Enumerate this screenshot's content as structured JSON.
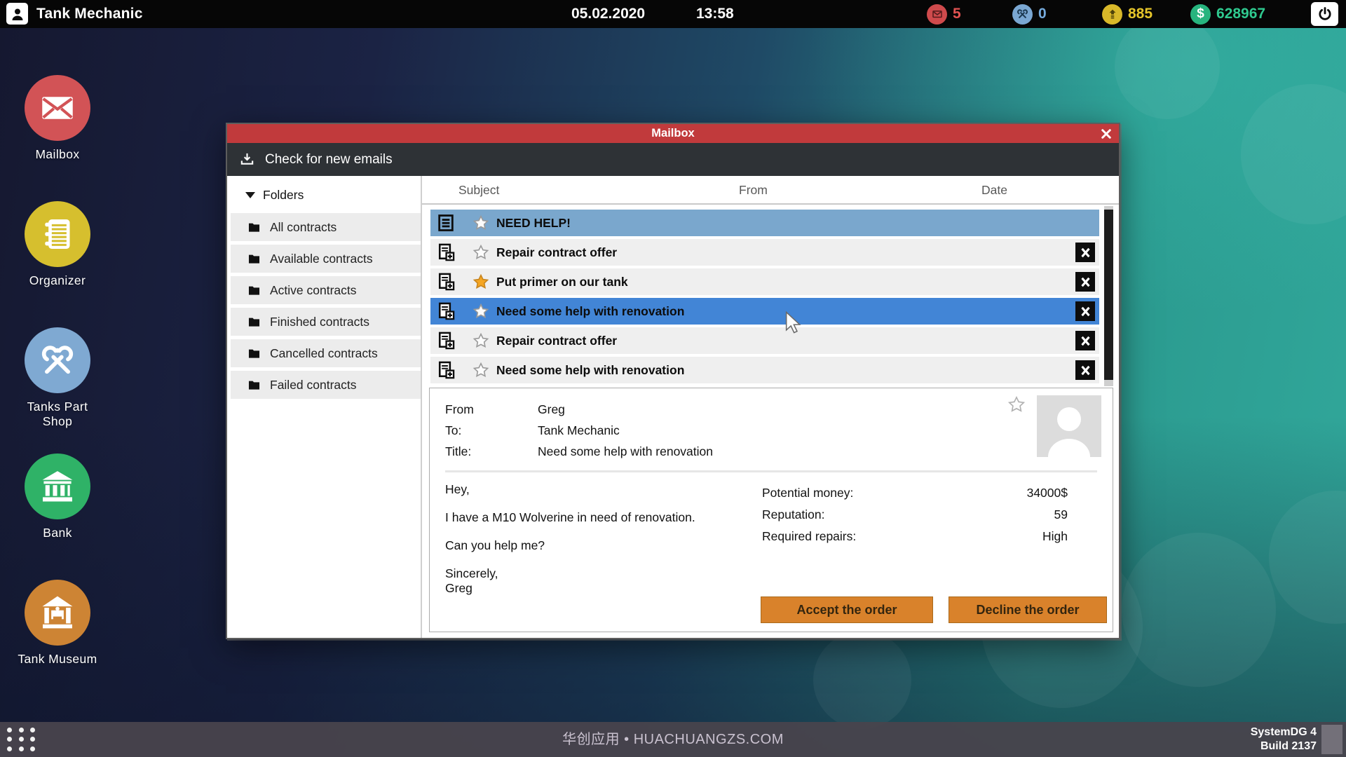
{
  "topbar": {
    "title": "Tank Mechanic",
    "date": "05.02.2020",
    "time": "13:58",
    "counters": {
      "mail": {
        "value": "5",
        "color": "#e25351",
        "badge": "#cf4a4c"
      },
      "repairs": {
        "value": "0",
        "color": "#76abdd",
        "badge": "#7aa7d2"
      },
      "reputation": {
        "value": "885",
        "color": "#e5c52a",
        "badge": "#d8b829"
      },
      "money": {
        "value": "628967",
        "color": "#2fc98f",
        "badge": "#27b47e"
      }
    }
  },
  "desktop": {
    "items": [
      {
        "label": "Mailbox",
        "color": "#d25356"
      },
      {
        "label": "Organizer",
        "color": "#d6bf2e"
      },
      {
        "label": "Tanks Part Shop",
        "color": "#7fa9d2"
      },
      {
        "label": "Bank",
        "color": "#2fb267"
      },
      {
        "label": "Tank Museum",
        "color": "#cd8434"
      }
    ]
  },
  "window": {
    "title": "Mailbox",
    "titlebar_color": "#c13a3c",
    "toolbar": {
      "check_label": "Check for new emails"
    },
    "folders": {
      "header": "Folders",
      "items": [
        "All contracts",
        "Available contracts",
        "Active contracts",
        "Finished contracts",
        "Cancelled contracts",
        "Failed contracts"
      ]
    },
    "list": {
      "columns": {
        "subject": "Subject",
        "from": "From",
        "date": "Date"
      },
      "rows": [
        {
          "subject": "NEED HELP!",
          "icon": "note",
          "star": "off",
          "state": "muted",
          "close": "no"
        },
        {
          "subject": "Repair contract offer",
          "icon": "contract",
          "star": "off",
          "state": "",
          "close": "yes"
        },
        {
          "subject": "Put primer on our tank",
          "icon": "contract",
          "star": "on",
          "state": "",
          "close": "yes"
        },
        {
          "subject": "Need some help with renovation",
          "icon": "contract",
          "star": "off",
          "state": "active",
          "close": "yes"
        },
        {
          "subject": "Repair contract offer",
          "icon": "contract",
          "star": "off",
          "state": "",
          "close": "yes"
        },
        {
          "subject": "Need some help with renovation",
          "icon": "contract",
          "star": "off",
          "state": "",
          "close": "yes"
        }
      ]
    },
    "detail": {
      "from_label": "From",
      "from_value": "Greg",
      "to_label": "To:",
      "to_value": "Tank Mechanic",
      "title_label": "Title:",
      "title_value": "Need some help with renovation",
      "body": [
        "Hey,",
        "I have a M10 Wolverine in need of renovation.",
        "Can you help me?",
        "Sincerely,\nGreg"
      ],
      "meta": [
        {
          "label": "Potential money:",
          "value": "34000$"
        },
        {
          "label": "Reputation:",
          "value": "59"
        },
        {
          "label": "Required repairs:",
          "value": "High"
        }
      ],
      "accept_label": "Accept the order",
      "decline_label": "Decline the order",
      "button_color": "#d9822b"
    }
  },
  "taskbar": {
    "center_text": "华创应用 • HUACHUANGZS.COM",
    "system_name": "SystemDG 4",
    "build": "Build 2137"
  }
}
